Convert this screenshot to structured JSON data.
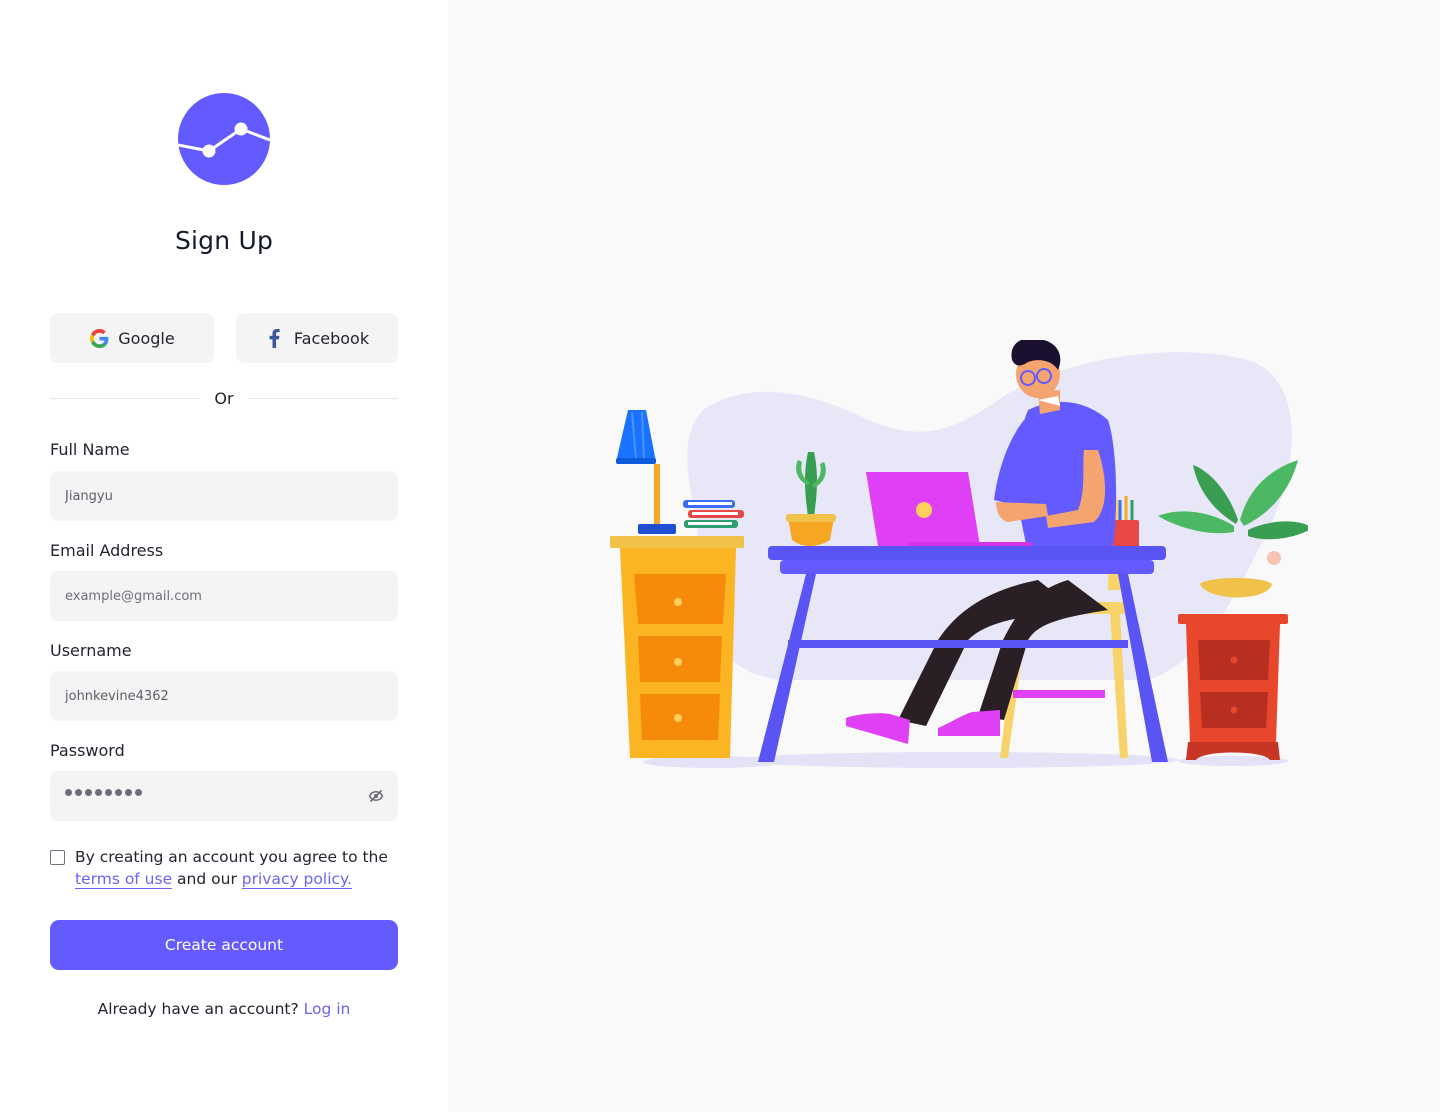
{
  "page": {
    "title": "Sign Up"
  },
  "brand": {
    "logo_icon": "chart-line-logo-icon",
    "accent_color": "#635bff"
  },
  "social": {
    "google_label": "Google",
    "facebook_label": "Facebook",
    "divider_text": "Or"
  },
  "form": {
    "full_name": {
      "label": "Full Name",
      "value": "Jiangyu"
    },
    "email": {
      "label": "Email Address",
      "placeholder": "example@gmail.com"
    },
    "username": {
      "label": "Username",
      "value": "johnkevine4362"
    },
    "password": {
      "label": "Password",
      "masked_length": 8
    },
    "terms": {
      "text_before": "By creating an account you agree to the ",
      "terms_link": "terms of use",
      "text_middle": " and our ",
      "privacy_link": "privacy policy.",
      "checked": false
    },
    "submit_label": "Create account"
  },
  "footer": {
    "prompt": "Already have an account? ",
    "login_link": "Log in"
  }
}
